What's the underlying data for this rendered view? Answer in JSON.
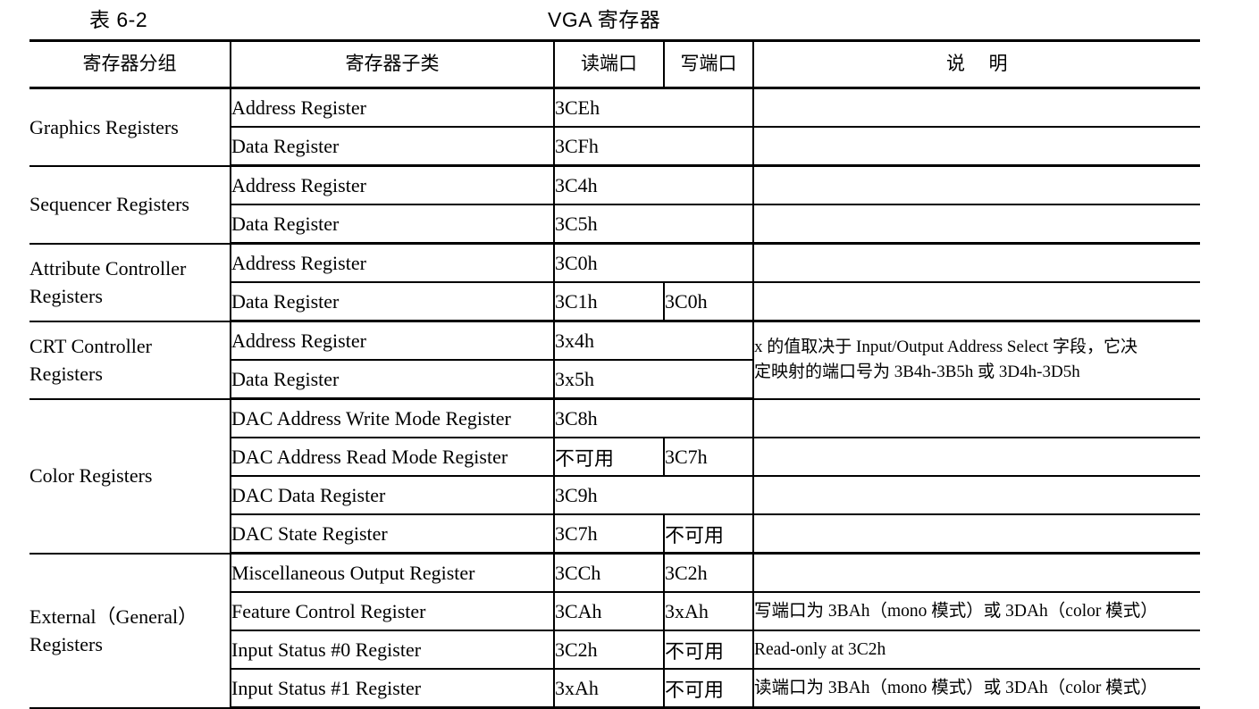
{
  "caption": {
    "label": "表 6-2",
    "title": "VGA 寄存器"
  },
  "table": {
    "headers": {
      "group": "寄存器分组",
      "subclass": "寄存器子类",
      "read_port": "读端口",
      "write_port": "写端口",
      "description_a": "说",
      "description_b": "明"
    },
    "groups": [
      {
        "name": "Graphics Registers",
        "rows": [
          {
            "subclass": "Address Register",
            "read": "3CEh",
            "write": "",
            "merged_port": true,
            "desc": ""
          },
          {
            "subclass": "Data Register",
            "read": "3CFh",
            "write": "",
            "merged_port": true,
            "desc": ""
          }
        ]
      },
      {
        "name": "Sequencer Registers",
        "rows": [
          {
            "subclass": "Address Register",
            "read": "3C4h",
            "write": "",
            "merged_port": true,
            "desc": ""
          },
          {
            "subclass": "Data Register",
            "read": "3C5h",
            "write": "",
            "merged_port": true,
            "desc": ""
          }
        ]
      },
      {
        "name": "Attribute Controller Registers",
        "rows": [
          {
            "subclass": "Address Register",
            "read": "3C0h",
            "write": "",
            "merged_port": true,
            "desc": ""
          },
          {
            "subclass": "Data Register",
            "read": "3C1h",
            "write": "3C0h",
            "merged_port": false,
            "desc": ""
          }
        ]
      },
      {
        "name": "CRT Controller Registers",
        "rows": [
          {
            "subclass": "Address Register",
            "read": "3x4h",
            "write": "",
            "merged_port": true
          },
          {
            "subclass": "Data Register",
            "read": "3x5h",
            "write": "",
            "merged_port": true
          }
        ],
        "desc_spanned": {
          "line1": "x 的值取决于 Input/Output Address Select 字段，它决",
          "line2": "定映射的端口号为 3B4h-3B5h 或 3D4h-3D5h"
        }
      },
      {
        "name": "Color Registers",
        "rows": [
          {
            "subclass": "DAC Address Write Mode Register",
            "read": "3C8h",
            "write": "",
            "merged_port": true,
            "desc": ""
          },
          {
            "subclass": "DAC Address Read Mode Register",
            "read": "不可用",
            "write": "3C7h",
            "merged_port": false,
            "desc": ""
          },
          {
            "subclass": "DAC Data Register",
            "read": "3C9h",
            "write": "",
            "merged_port": true,
            "desc": ""
          },
          {
            "subclass": "DAC State Register",
            "read": "3C7h",
            "write": "不可用",
            "merged_port": false,
            "desc": ""
          }
        ]
      },
      {
        "name": "External（General）Registers",
        "rows": [
          {
            "subclass": "Miscellaneous Output Register",
            "read": "3CCh",
            "write": "3C2h",
            "merged_port": false,
            "desc": ""
          },
          {
            "subclass": "Feature Control Register",
            "read": "3CAh",
            "write": "3xAh",
            "merged_port": false,
            "desc": "写端口为 3BAh（mono 模式）或 3DAh（color 模式）"
          },
          {
            "subclass": "Input Status #0 Register",
            "read": "3C2h",
            "write": "不可用",
            "merged_port": false,
            "desc": "Read-only at 3C2h"
          },
          {
            "subclass": "Input Status #1 Register",
            "read": "3xAh",
            "write": "不可用",
            "merged_port": false,
            "desc": "读端口为 3BAh（mono 模式）或 3DAh（color 模式）"
          }
        ]
      }
    ]
  }
}
